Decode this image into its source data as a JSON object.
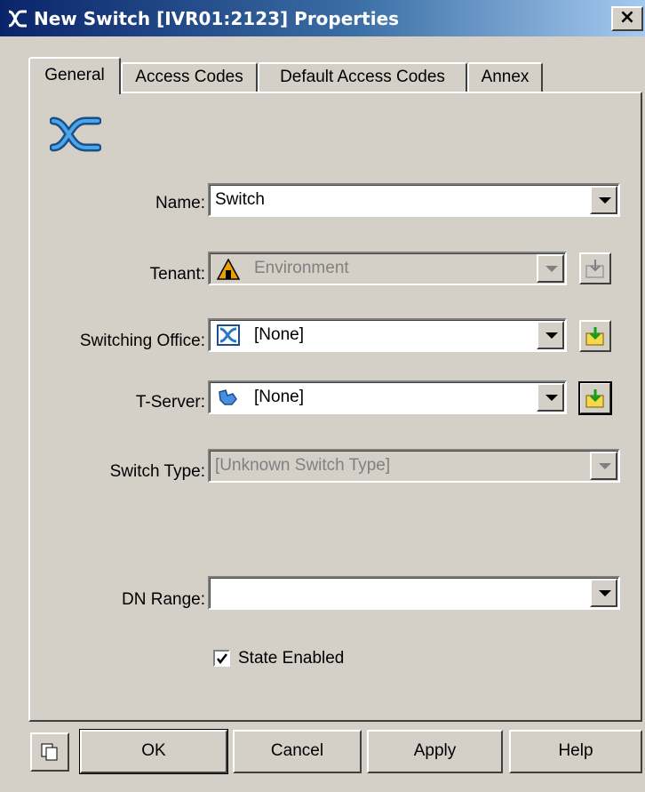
{
  "window": {
    "title": "New Switch [IVR01:2123] Properties",
    "close_label": "×"
  },
  "tabs": [
    {
      "label": "General",
      "active": true
    },
    {
      "label": "Access Codes",
      "active": false
    },
    {
      "label": "Default Access Codes",
      "active": false
    },
    {
      "label": "Annex",
      "active": false
    }
  ],
  "form": {
    "name": {
      "label": "Name:",
      "value": "Switch"
    },
    "tenant": {
      "label": "Tenant:",
      "value": "Environment",
      "disabled": true
    },
    "switching_office": {
      "label": "Switching Office:",
      "value": "[None]"
    },
    "t_server": {
      "label": "T-Server:",
      "value": "[None]"
    },
    "switch_type": {
      "label": "Switch Type:",
      "value": "[Unknown Switch Type]",
      "disabled": true
    },
    "dn_range": {
      "label": "DN Range:",
      "value": ""
    },
    "state_enabled": {
      "label": "State Enabled",
      "checked": true
    }
  },
  "buttons": {
    "ok": "OK",
    "cancel": "Cancel",
    "apply": "Apply",
    "help": "Help"
  },
  "icons": {
    "title": "switch-icon",
    "header": "switch-icon",
    "tenant": "tenant-icon",
    "office": "switching-office-icon",
    "tserver": "t-server-icon",
    "browse": "folder-browse-icon",
    "copy": "copy-icon"
  }
}
